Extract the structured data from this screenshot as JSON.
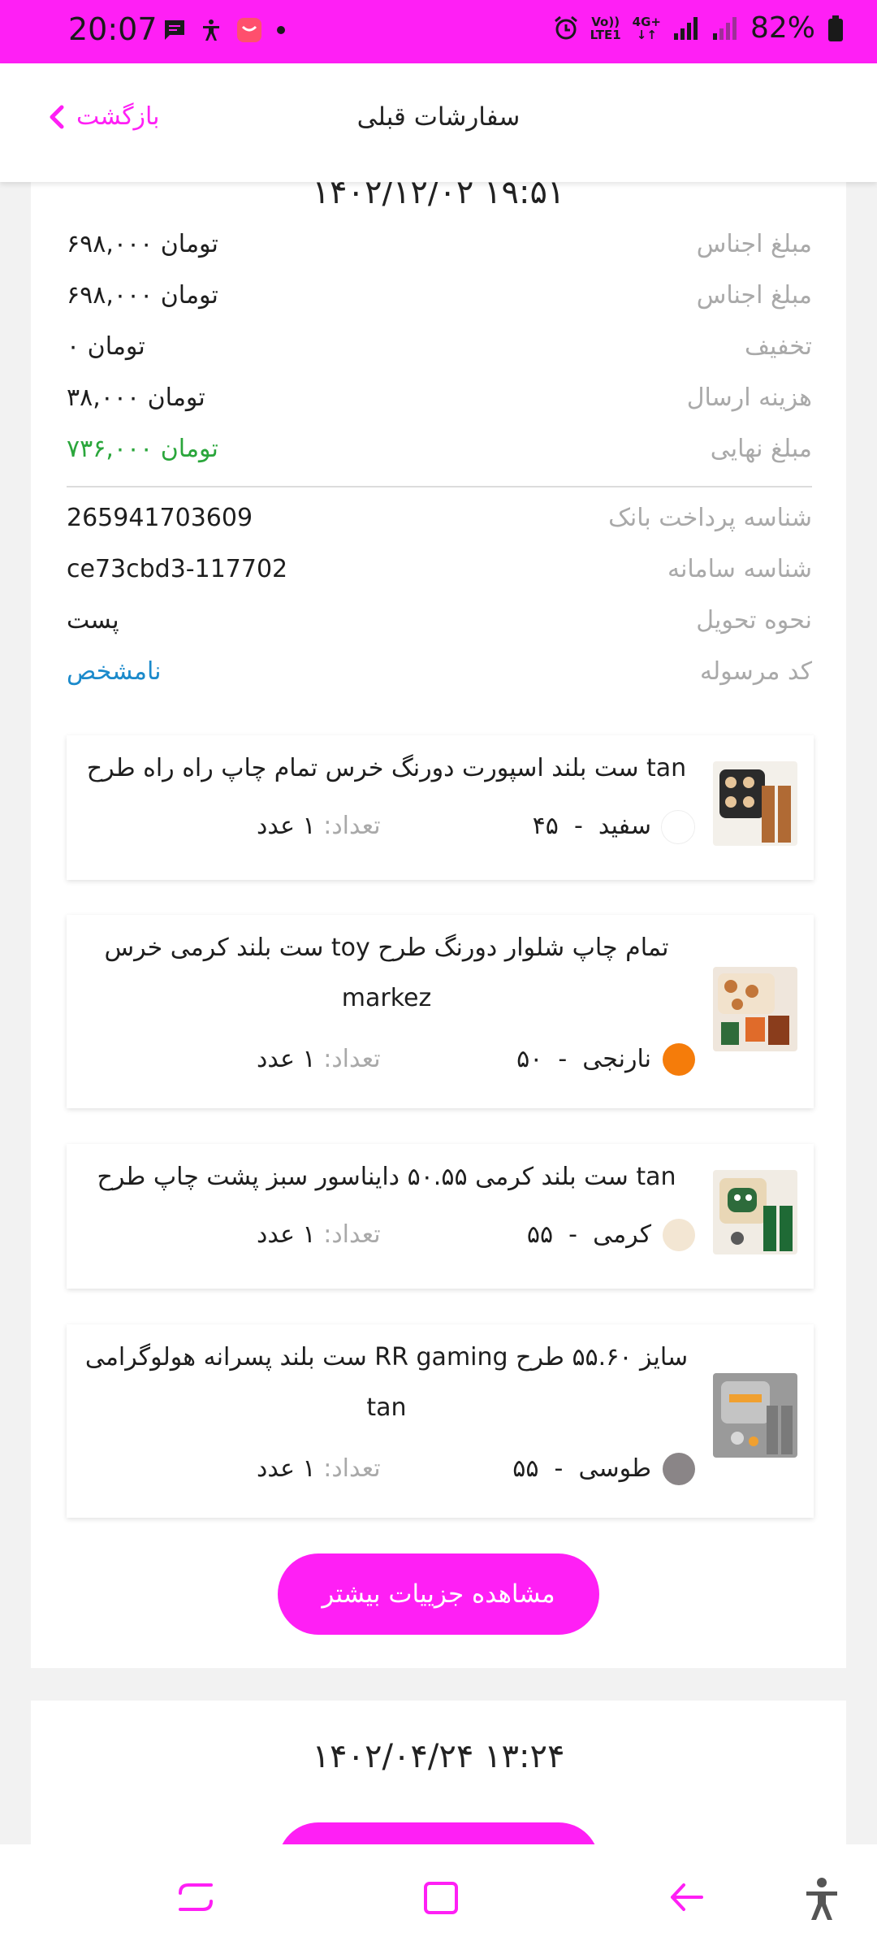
{
  "status_bar": {
    "time": "20:07",
    "net_label_top": "Vo))",
    "net_label_bottom": "LTE1",
    "net_type": "4G+",
    "battery": "82%"
  },
  "header": {
    "title": "سفارشات قبلی",
    "back_label": "بازگشت"
  },
  "orders": [
    {
      "datetime": "۱۴۰۲/۱۲/۰۲ ۱۹:۵۱",
      "summary": [
        {
          "label": "مبلغ اجناس",
          "value": "۶۹۸,۰۰۰ تومان"
        },
        {
          "label": "مبلغ اجناس",
          "value": "۶۹۸,۰۰۰ تومان"
        },
        {
          "label": "تخفیف",
          "value": "۰ تومان"
        },
        {
          "label": "هزینه ارسال",
          "value": "۳۸,۰۰۰ تومان"
        },
        {
          "label": "مبلغ نهایی",
          "value": "۷۳۶,۰۰۰ تومان"
        }
      ],
      "details": [
        {
          "label": "شناسه پرداخت بانک",
          "value": "265941703609"
        },
        {
          "label": "شناسه سامانه",
          "value": "ce73cbd3-117702"
        },
        {
          "label": "نحوه تحویل",
          "value": "پست"
        },
        {
          "label": "کد مرسوله",
          "value": "نامشخص"
        }
      ],
      "items": [
        {
          "title": "ست بلند اسپورت دورنگ خرس تمام چاپ راه راه طرح tan",
          "color_name": "سفید",
          "size": "۴۵",
          "qty_label": "تعداد:",
          "qty_value": "۱ عدد",
          "dot_color": "#ffffff"
        },
        {
          "title": "ست بلند کرمی خرس toy تمام چاپ شلوار دورنگ طرح markez",
          "color_name": "نارنجی",
          "size": "۵۰",
          "qty_label": "تعداد:",
          "qty_value": "۱ عدد",
          "dot_color": "#f57c0a"
        },
        {
          "title": "ست بلند کرمی ۵۰.۵۵ دایناسور سبز پشت چاپ طرح tan",
          "color_name": "کرمی",
          "size": "۵۵",
          "qty_label": "تعداد:",
          "qty_value": "۱ عدد",
          "dot_color": "#f3e6d3"
        },
        {
          "title": "ست بلند پسرانه هولوگرامی RR gaming سایز ۵۵.۶۰ طرح tan",
          "color_name": "طوسی",
          "size": "۵۵",
          "qty_label": "تعداد:",
          "qty_value": "۱ عدد",
          "dot_color": "#8a8587"
        }
      ],
      "more_button": "مشاهده جزییات بیشتر"
    },
    {
      "datetime": "۱۴۰۲/۰۴/۲۴ ۱۳:۲۴"
    }
  ],
  "colors": {
    "accent": "#ff1ff5",
    "final_amount": "#2aa63b",
    "tracking_link": "#1b8acb"
  }
}
